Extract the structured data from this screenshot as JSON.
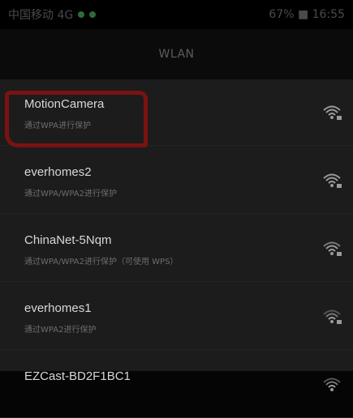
{
  "status_bar": {
    "carrier": "中国移动 4G",
    "battery_time": "67% ■ 16:55"
  },
  "header": {
    "title": "WLAN"
  },
  "networks": [
    {
      "ssid": "MotionCamera",
      "security": "通过WPA进行保护",
      "highlighted": true
    },
    {
      "ssid": "everhomes2",
      "security": "通过WPA/WPA2进行保护"
    },
    {
      "ssid": "ChinaNet-5Nqm",
      "security": "通过WPA/WPA2进行保护（可使用 WPS）"
    },
    {
      "ssid": "everhomes1",
      "security": "通过WPA2进行保护"
    },
    {
      "ssid": "EZCast-BD2F1BC1",
      "security": ""
    }
  ],
  "colors": {
    "highlight": "#7a1212",
    "list_background": "#1c1c1c"
  },
  "icons": {
    "network_signal": "wifi-signal-lock-icon"
  }
}
